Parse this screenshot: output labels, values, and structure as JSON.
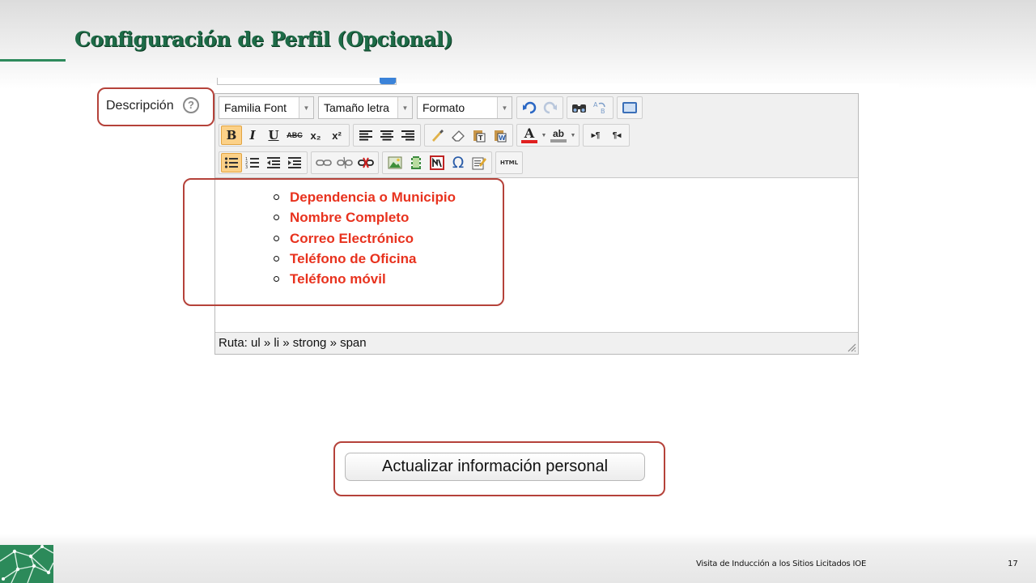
{
  "slide": {
    "title": "Configuración de Perfil (Opcional)",
    "footer_text": "Visita de Inducción a los Sitios Licitados IOE",
    "page_number": "17"
  },
  "field": {
    "label": "Descripción",
    "help_symbol": "?"
  },
  "editor": {
    "dropdowns": {
      "font_family": "Familia Font",
      "font_size": "Tamaño letra",
      "format": "Formato"
    },
    "toolbar_icons": {
      "row1": [
        "undo-icon",
        "redo-icon",
        "find-icon",
        "replace-icon",
        "fullscreen-icon"
      ],
      "row2": [
        "bold-icon",
        "italic-icon",
        "underline-icon",
        "strikethrough-icon",
        "subscript-icon",
        "superscript-icon",
        "align-left-icon",
        "align-center-icon",
        "align-right-icon",
        "cleanup-icon",
        "eraser-icon",
        "paste-text-icon",
        "paste-word-icon",
        "text-color-icon",
        "highlight-color-icon",
        "ltr-icon",
        "rtl-icon"
      ],
      "row3": [
        "bullet-list-icon",
        "numbered-list-icon",
        "outdent-icon",
        "indent-icon",
        "link-icon",
        "unlink-icon",
        "anchor-icon",
        "image-icon",
        "media-icon",
        "nolink-icon",
        "special-char-icon",
        "edit-icon",
        "html-icon"
      ]
    },
    "labels": {
      "bold": "B",
      "italic": "I",
      "underline": "U",
      "strike": "ABC",
      "sub": "x₂",
      "sup": "x²",
      "text_color": "A",
      "highlight": "ab",
      "omega": "Ω",
      "html": "HTML",
      "ltr": "▸¶",
      "rtl": "¶◂"
    },
    "content_items": [
      "Dependencia o Municipio",
      "Nombre Completo",
      "Correo Electrónico",
      "Teléfono de Oficina",
      "Teléfono móvil"
    ],
    "status_path": "Ruta: ul » li » strong » span"
  },
  "update_button": "Actualizar información personal",
  "colors": {
    "title": "#1d6b47",
    "highlight_border": "#b5423a",
    "content_text": "#e8321e",
    "brand_green": "#2c8a5a"
  }
}
